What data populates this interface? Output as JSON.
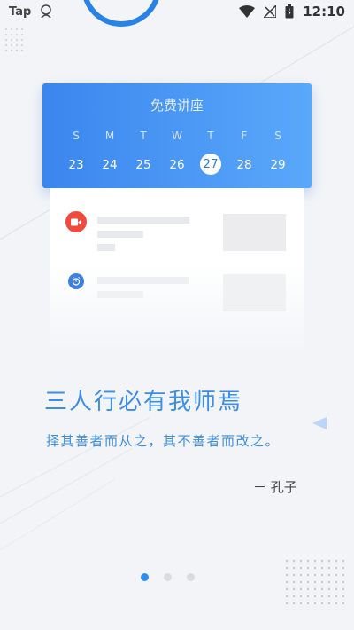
{
  "status_bar": {
    "app_label": "Tap",
    "time": "12:10"
  },
  "calendar": {
    "title": "免费讲座",
    "weekdays": [
      "S",
      "M",
      "T",
      "W",
      "T",
      "F",
      "S"
    ],
    "days": [
      "23",
      "24",
      "25",
      "26",
      "27",
      "28",
      "29"
    ],
    "selected_index": 4
  },
  "quote": {
    "title": "三人行必有我师焉",
    "text": "择其善者而从之，其不善者而改之。",
    "author": "－ 孔子"
  },
  "pager": {
    "count": 3,
    "active_index": 0
  },
  "colors": {
    "accent": "#2f8ef0",
    "record_red": "#ef4a3c"
  }
}
